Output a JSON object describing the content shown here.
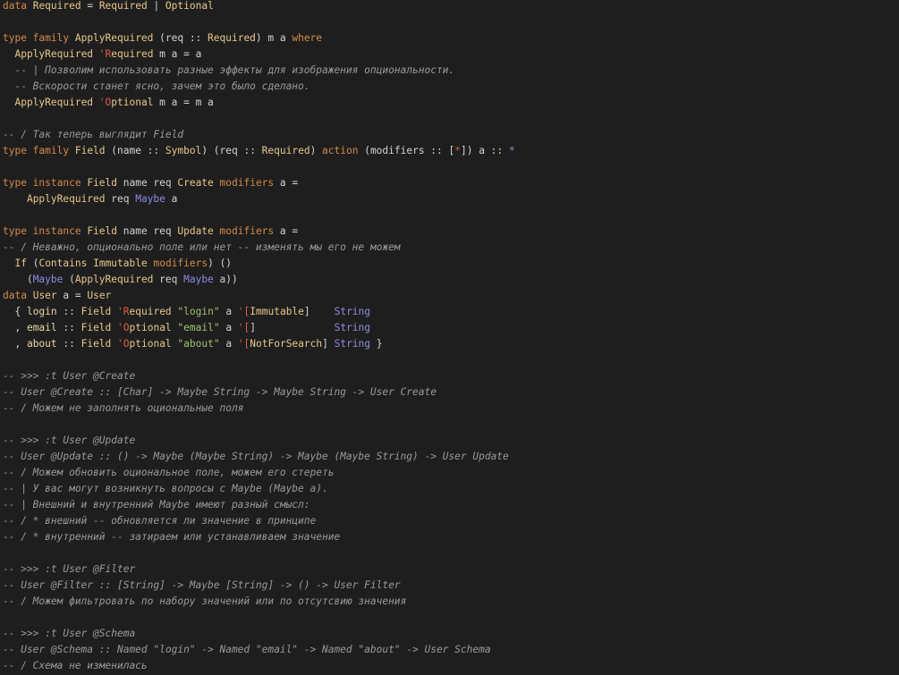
{
  "editor": {
    "background": "#1e1e1e",
    "palette": {
      "keyword": "#d68a47",
      "type": "#e8c88a",
      "comment": "#9a9a9a",
      "string": "#a3c26c",
      "constructor": "#8c8ce6",
      "tick": "#e05a47"
    },
    "lines": [
      [
        [
          "keyword",
          "data"
        ],
        [
          "default",
          " "
        ],
        [
          "type",
          "Required"
        ],
        [
          "default",
          " = "
        ],
        [
          "type",
          "Required"
        ],
        [
          "default",
          " | "
        ],
        [
          "type",
          "Optional"
        ]
      ],
      [],
      [
        [
          "keyword",
          "type family"
        ],
        [
          "default",
          " "
        ],
        [
          "type",
          "ApplyRequired"
        ],
        [
          "default",
          " (req :: "
        ],
        [
          "type",
          "Required"
        ],
        [
          "default",
          ") m a "
        ],
        [
          "keyword",
          "where"
        ]
      ],
      [
        [
          "default",
          "  "
        ],
        [
          "type",
          "ApplyRequired"
        ],
        [
          "default",
          " "
        ],
        [
          "tick",
          "'R"
        ],
        [
          "type",
          "equired"
        ],
        [
          "default",
          " m a = a"
        ]
      ],
      [
        [
          "comment",
          "  -- | Позволим использовать разные эффекты для изображения опциональности."
        ]
      ],
      [
        [
          "comment",
          "  -- Вскорости станет ясно, зачем это было сделано."
        ]
      ],
      [
        [
          "default",
          "  "
        ],
        [
          "type",
          "ApplyRequired"
        ],
        [
          "default",
          " "
        ],
        [
          "tick",
          "'O"
        ],
        [
          "type",
          "ptional"
        ],
        [
          "default",
          " m a = m a"
        ]
      ],
      [],
      [
        [
          "comment",
          "-- / Так теперь выглядит Field"
        ]
      ],
      [
        [
          "keyword",
          "type family"
        ],
        [
          "default",
          " "
        ],
        [
          "type",
          "Field"
        ],
        [
          "default",
          " (name :: "
        ],
        [
          "type",
          "Symbol"
        ],
        [
          "default",
          ") (req :: "
        ],
        [
          "type",
          "Required"
        ],
        [
          "default",
          ") "
        ],
        [
          "keyword",
          "action"
        ],
        [
          "default",
          " (modifiers :: ["
        ],
        [
          "tick",
          "*"
        ],
        [
          "default",
          "]) a :: "
        ],
        [
          "constructor",
          "*"
        ]
      ],
      [],
      [
        [
          "keyword",
          "type instance"
        ],
        [
          "default",
          " "
        ],
        [
          "type",
          "Field"
        ],
        [
          "default",
          " name req "
        ],
        [
          "type",
          "Create"
        ],
        [
          "default",
          " "
        ],
        [
          "keyword",
          "modifiers"
        ],
        [
          "default",
          " a ="
        ]
      ],
      [
        [
          "default",
          "    "
        ],
        [
          "type",
          "ApplyRequired"
        ],
        [
          "default",
          " req "
        ],
        [
          "constructor",
          "Maybe"
        ],
        [
          "default",
          " a"
        ]
      ],
      [],
      [
        [
          "keyword",
          "type instance"
        ],
        [
          "default",
          " "
        ],
        [
          "type",
          "Field"
        ],
        [
          "default",
          " name req "
        ],
        [
          "type",
          "Update"
        ],
        [
          "default",
          " "
        ],
        [
          "keyword",
          "modifiers"
        ],
        [
          "default",
          " a ="
        ]
      ],
      [
        [
          "comment",
          "-- / Неважно, опционально поле или нет -- изменять мы его не можем"
        ]
      ],
      [
        [
          "default",
          "  "
        ],
        [
          "type",
          "If"
        ],
        [
          "default",
          " ("
        ],
        [
          "type",
          "Contains"
        ],
        [
          "default",
          " "
        ],
        [
          "type",
          "Immutable"
        ],
        [
          "default",
          " "
        ],
        [
          "keyword",
          "modifiers"
        ],
        [
          "default",
          ") ()"
        ]
      ],
      [
        [
          "default",
          "    ("
        ],
        [
          "constructor",
          "Maybe"
        ],
        [
          "default",
          " ("
        ],
        [
          "type",
          "ApplyRequired"
        ],
        [
          "default",
          " req "
        ],
        [
          "constructor",
          "Maybe"
        ],
        [
          "default",
          " a))"
        ]
      ],
      [
        [
          "keyword",
          "data"
        ],
        [
          "default",
          " "
        ],
        [
          "type",
          "User"
        ],
        [
          "default",
          " a = "
        ],
        [
          "type",
          "User"
        ]
      ],
      [
        [
          "default",
          "  { "
        ],
        [
          "ident",
          "login"
        ],
        [
          "default",
          " :: "
        ],
        [
          "type",
          "Field"
        ],
        [
          "default",
          " "
        ],
        [
          "tick",
          "'R"
        ],
        [
          "type",
          "equired"
        ],
        [
          "default",
          " "
        ],
        [
          "string",
          "\"login\""
        ],
        [
          "default",
          " a "
        ],
        [
          "tick",
          "'["
        ],
        [
          "type",
          "Immutable"
        ],
        [
          "default",
          "]    "
        ],
        [
          "constructor",
          "String"
        ]
      ],
      [
        [
          "default",
          "  , "
        ],
        [
          "ident",
          "email"
        ],
        [
          "default",
          " :: "
        ],
        [
          "type",
          "Field"
        ],
        [
          "default",
          " "
        ],
        [
          "tick",
          "'O"
        ],
        [
          "type",
          "ptional"
        ],
        [
          "default",
          " "
        ],
        [
          "string",
          "\"email\""
        ],
        [
          "default",
          " a "
        ],
        [
          "tick",
          "'["
        ],
        [
          "default",
          "]             "
        ],
        [
          "constructor",
          "String"
        ]
      ],
      [
        [
          "default",
          "  , "
        ],
        [
          "ident",
          "about"
        ],
        [
          "default",
          " :: "
        ],
        [
          "type",
          "Field"
        ],
        [
          "default",
          " "
        ],
        [
          "tick",
          "'O"
        ],
        [
          "type",
          "ptional"
        ],
        [
          "default",
          " "
        ],
        [
          "string",
          "\"about\""
        ],
        [
          "default",
          " a "
        ],
        [
          "tick",
          "'["
        ],
        [
          "type",
          "NotForSearch"
        ],
        [
          "default",
          "] "
        ],
        [
          "constructor",
          "String"
        ],
        [
          "default",
          " }"
        ]
      ],
      [],
      [
        [
          "comment",
          "-- >>> :t User @Create"
        ]
      ],
      [
        [
          "comment",
          "-- User @Create :: [Char] -> Maybe String -> Maybe String -> User Create"
        ]
      ],
      [
        [
          "comment",
          "-- / Можем не заполнять оциональные поля"
        ]
      ],
      [],
      [
        [
          "comment",
          "-- >>> :t User @Update"
        ]
      ],
      [
        [
          "comment",
          "-- User @Update :: () -> Maybe (Maybe String) -> Maybe (Maybe String) -> User Update"
        ]
      ],
      [
        [
          "comment",
          "-- / Можем обновить оциональное поле, можем его стереть"
        ]
      ],
      [
        [
          "comment",
          "-- | У вас могут возникнуть вопросы с Maybe (Maybe a)."
        ]
      ],
      [
        [
          "comment",
          "-- | Внешний и внутренний Maybe имеют разный смысл:"
        ]
      ],
      [
        [
          "comment",
          "-- / * внешний -- обновляется ли значение в принципе"
        ]
      ],
      [
        [
          "comment",
          "-- / * внутренний -- затираем или устанавливаем значение"
        ]
      ],
      [],
      [
        [
          "comment",
          "-- >>> :t User @Filter"
        ]
      ],
      [
        [
          "comment",
          "-- User @Filter :: [String] -> Maybe [String] -> () -> User Filter"
        ]
      ],
      [
        [
          "comment",
          "-- / Можем фильтровать по набору значений или по отсутсвию значения"
        ]
      ],
      [],
      [
        [
          "comment",
          "-- >>> :t User @Schema"
        ]
      ],
      [
        [
          "comment",
          "-- User @Schema :: Named \"login\" -> Named \"email\" -> Named \"about\" -> User Schema"
        ]
      ],
      [
        [
          "comment",
          "-- / Схема не изменилась"
        ]
      ]
    ]
  }
}
